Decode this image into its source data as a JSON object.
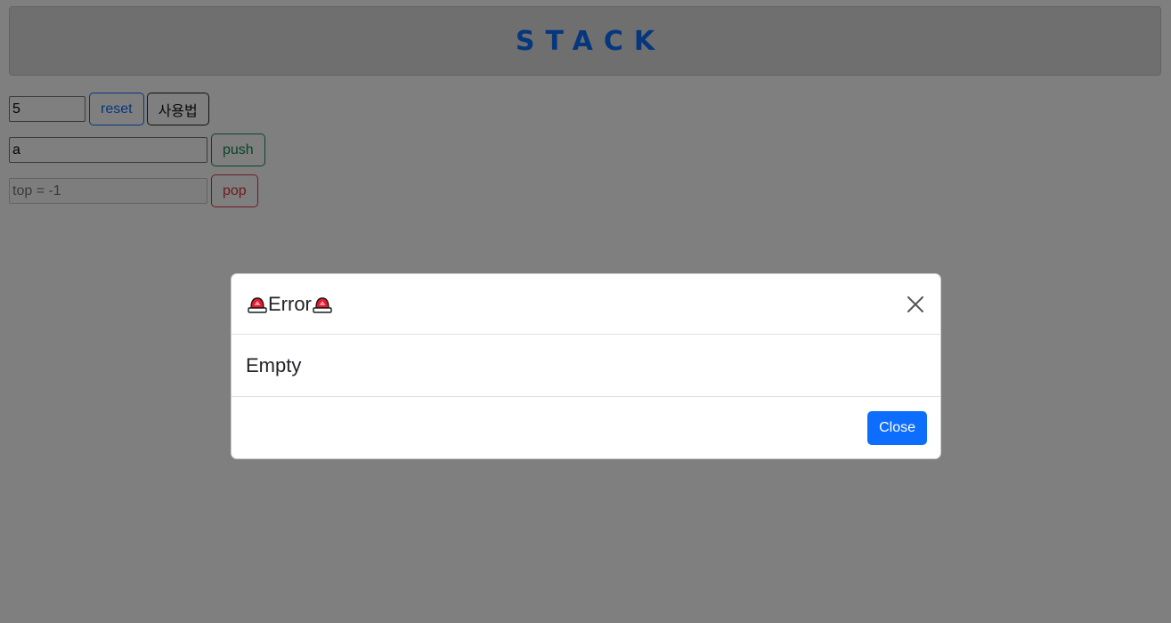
{
  "header": {
    "title": "STACK"
  },
  "controls": {
    "size_input_value": "5",
    "reset_label": "reset",
    "howto_label": "사용법",
    "value_input_value": "a",
    "push_label": "push",
    "top_display_placeholder": "top = -1",
    "pop_label": "pop"
  },
  "modal": {
    "title": "Error",
    "title_icon": "police-light-icon",
    "message": "Empty",
    "close_label": "Close",
    "close_icon": "close-icon"
  },
  "colors": {
    "primary": "#0d6efd",
    "success": "#198754",
    "danger": "#dc3545",
    "backdrop": "rgba(0,0,0,0.5)"
  }
}
